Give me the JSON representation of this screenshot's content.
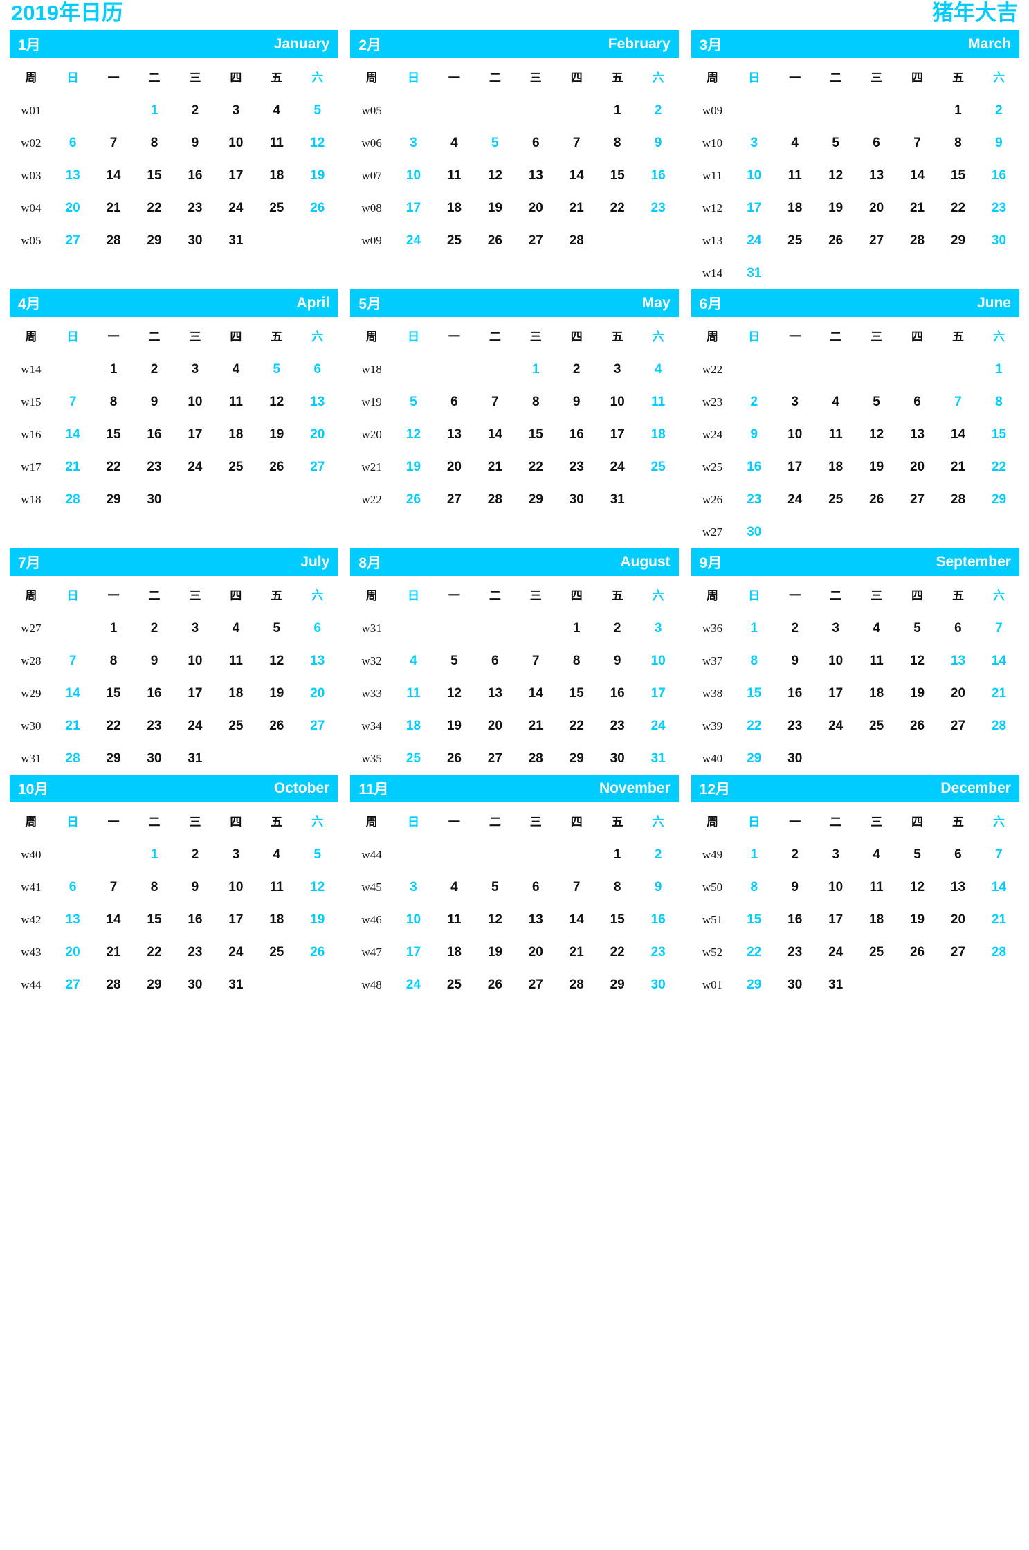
{
  "page": {
    "title_left": "2019年日历",
    "title_right": "猪年大吉",
    "accent_color": "#00ccff",
    "text_color": "#111111",
    "background_color": "#ffffff"
  },
  "weekday_headers": {
    "week_label": "周",
    "days": [
      "日",
      "一",
      "二",
      "三",
      "四",
      "五",
      "六"
    ],
    "weekend_indices": [
      0,
      6
    ]
  },
  "months": [
    {
      "cn": "1月",
      "en": "January",
      "weeks": [
        {
          "w": "w01",
          "days": [
            "",
            "",
            "1",
            "2",
            "3",
            "4",
            "5"
          ],
          "hl": [
            2,
            6
          ]
        },
        {
          "w": "w02",
          "days": [
            "6",
            "7",
            "8",
            "9",
            "10",
            "11",
            "12"
          ],
          "hl": [
            0,
            6
          ]
        },
        {
          "w": "w03",
          "days": [
            "13",
            "14",
            "15",
            "16",
            "17",
            "18",
            "19"
          ],
          "hl": [
            0,
            6
          ]
        },
        {
          "w": "w04",
          "days": [
            "20",
            "21",
            "22",
            "23",
            "24",
            "25",
            "26"
          ],
          "hl": [
            0,
            6
          ]
        },
        {
          "w": "w05",
          "days": [
            "27",
            "28",
            "29",
            "30",
            "31",
            "",
            ""
          ],
          "hl": [
            0
          ]
        }
      ]
    },
    {
      "cn": "2月",
      "en": "February",
      "weeks": [
        {
          "w": "w05",
          "days": [
            "",
            "",
            "",
            "",
            "",
            "1",
            "2"
          ],
          "hl": [
            6
          ]
        },
        {
          "w": "w06",
          "days": [
            "3",
            "4",
            "5",
            "6",
            "7",
            "8",
            "9"
          ],
          "hl": [
            0,
            2,
            6
          ]
        },
        {
          "w": "w07",
          "days": [
            "10",
            "11",
            "12",
            "13",
            "14",
            "15",
            "16"
          ],
          "hl": [
            0,
            6
          ]
        },
        {
          "w": "w08",
          "days": [
            "17",
            "18",
            "19",
            "20",
            "21",
            "22",
            "23"
          ],
          "hl": [
            0,
            6
          ]
        },
        {
          "w": "w09",
          "days": [
            "24",
            "25",
            "26",
            "27",
            "28",
            "",
            ""
          ],
          "hl": [
            0
          ]
        }
      ]
    },
    {
      "cn": "3月",
      "en": "March",
      "weeks": [
        {
          "w": "w09",
          "days": [
            "",
            "",
            "",
            "",
            "",
            "1",
            "2"
          ],
          "hl": [
            6
          ]
        },
        {
          "w": "w10",
          "days": [
            "3",
            "4",
            "5",
            "6",
            "7",
            "8",
            "9"
          ],
          "hl": [
            0,
            6
          ]
        },
        {
          "w": "w11",
          "days": [
            "10",
            "11",
            "12",
            "13",
            "14",
            "15",
            "16"
          ],
          "hl": [
            0,
            6
          ]
        },
        {
          "w": "w12",
          "days": [
            "17",
            "18",
            "19",
            "20",
            "21",
            "22",
            "23"
          ],
          "hl": [
            0,
            6
          ]
        },
        {
          "w": "w13",
          "days": [
            "24",
            "25",
            "26",
            "27",
            "28",
            "29",
            "30"
          ],
          "hl": [
            0,
            6
          ]
        },
        {
          "w": "w14",
          "days": [
            "31",
            "",
            "",
            "",
            "",
            "",
            ""
          ],
          "hl": [
            0
          ]
        }
      ]
    },
    {
      "cn": "4月",
      "en": "April",
      "weeks": [
        {
          "w": "w14",
          "days": [
            "",
            "1",
            "2",
            "3",
            "4",
            "5",
            "6"
          ],
          "hl": [
            5,
            6
          ]
        },
        {
          "w": "w15",
          "days": [
            "7",
            "8",
            "9",
            "10",
            "11",
            "12",
            "13"
          ],
          "hl": [
            0,
            6
          ]
        },
        {
          "w": "w16",
          "days": [
            "14",
            "15",
            "16",
            "17",
            "18",
            "19",
            "20"
          ],
          "hl": [
            0,
            6
          ]
        },
        {
          "w": "w17",
          "days": [
            "21",
            "22",
            "23",
            "24",
            "25",
            "26",
            "27"
          ],
          "hl": [
            0,
            6
          ]
        },
        {
          "w": "w18",
          "days": [
            "28",
            "29",
            "30",
            "",
            "",
            "",
            ""
          ],
          "hl": [
            0
          ]
        }
      ]
    },
    {
      "cn": "5月",
      "en": "May",
      "weeks": [
        {
          "w": "w18",
          "days": [
            "",
            "",
            "",
            "1",
            "2",
            "3",
            "4"
          ],
          "hl": [
            3,
            6
          ]
        },
        {
          "w": "w19",
          "days": [
            "5",
            "6",
            "7",
            "8",
            "9",
            "10",
            "11"
          ],
          "hl": [
            0,
            6
          ]
        },
        {
          "w": "w20",
          "days": [
            "12",
            "13",
            "14",
            "15",
            "16",
            "17",
            "18"
          ],
          "hl": [
            0,
            6
          ]
        },
        {
          "w": "w21",
          "days": [
            "19",
            "20",
            "21",
            "22",
            "23",
            "24",
            "25"
          ],
          "hl": [
            0,
            6
          ]
        },
        {
          "w": "w22",
          "days": [
            "26",
            "27",
            "28",
            "29",
            "30",
            "31",
            ""
          ],
          "hl": [
            0
          ]
        }
      ]
    },
    {
      "cn": "6月",
      "en": "June",
      "weeks": [
        {
          "w": "w22",
          "days": [
            "",
            "",
            "",
            "",
            "",
            "",
            "1"
          ],
          "hl": [
            6
          ]
        },
        {
          "w": "w23",
          "days": [
            "2",
            "3",
            "4",
            "5",
            "6",
            "7",
            "8"
          ],
          "hl": [
            0,
            5,
            6
          ]
        },
        {
          "w": "w24",
          "days": [
            "9",
            "10",
            "11",
            "12",
            "13",
            "14",
            "15"
          ],
          "hl": [
            0,
            6
          ]
        },
        {
          "w": "w25",
          "days": [
            "16",
            "17",
            "18",
            "19",
            "20",
            "21",
            "22"
          ],
          "hl": [
            0,
            6
          ]
        },
        {
          "w": "w26",
          "days": [
            "23",
            "24",
            "25",
            "26",
            "27",
            "28",
            "29"
          ],
          "hl": [
            0,
            6
          ]
        },
        {
          "w": "w27",
          "days": [
            "30",
            "",
            "",
            "",
            "",
            "",
            ""
          ],
          "hl": [
            0
          ]
        }
      ]
    },
    {
      "cn": "7月",
      "en": "July",
      "weeks": [
        {
          "w": "w27",
          "days": [
            "",
            "1",
            "2",
            "3",
            "4",
            "5",
            "6"
          ],
          "hl": [
            6
          ]
        },
        {
          "w": "w28",
          "days": [
            "7",
            "8",
            "9",
            "10",
            "11",
            "12",
            "13"
          ],
          "hl": [
            0,
            6
          ]
        },
        {
          "w": "w29",
          "days": [
            "14",
            "15",
            "16",
            "17",
            "18",
            "19",
            "20"
          ],
          "hl": [
            0,
            6
          ]
        },
        {
          "w": "w30",
          "days": [
            "21",
            "22",
            "23",
            "24",
            "25",
            "26",
            "27"
          ],
          "hl": [
            0,
            6
          ]
        },
        {
          "w": "w31",
          "days": [
            "28",
            "29",
            "30",
            "31",
            "",
            "",
            ""
          ],
          "hl": [
            0
          ]
        }
      ]
    },
    {
      "cn": "8月",
      "en": "August",
      "weeks": [
        {
          "w": "w31",
          "days": [
            "",
            "",
            "",
            "",
            "1",
            "2",
            "3"
          ],
          "hl": [
            6
          ]
        },
        {
          "w": "w32",
          "days": [
            "4",
            "5",
            "6",
            "7",
            "8",
            "9",
            "10"
          ],
          "hl": [
            0,
            6
          ]
        },
        {
          "w": "w33",
          "days": [
            "11",
            "12",
            "13",
            "14",
            "15",
            "16",
            "17"
          ],
          "hl": [
            0,
            6
          ]
        },
        {
          "w": "w34",
          "days": [
            "18",
            "19",
            "20",
            "21",
            "22",
            "23",
            "24"
          ],
          "hl": [
            0,
            6
          ]
        },
        {
          "w": "w35",
          "days": [
            "25",
            "26",
            "27",
            "28",
            "29",
            "30",
            "31"
          ],
          "hl": [
            0,
            6
          ]
        }
      ]
    },
    {
      "cn": "9月",
      "en": "September",
      "weeks": [
        {
          "w": "w36",
          "days": [
            "1",
            "2",
            "3",
            "4",
            "5",
            "6",
            "7"
          ],
          "hl": [
            0,
            6
          ]
        },
        {
          "w": "w37",
          "days": [
            "8",
            "9",
            "10",
            "11",
            "12",
            "13",
            "14"
          ],
          "hl": [
            0,
            5,
            6
          ]
        },
        {
          "w": "w38",
          "days": [
            "15",
            "16",
            "17",
            "18",
            "19",
            "20",
            "21"
          ],
          "hl": [
            0,
            6
          ]
        },
        {
          "w": "w39",
          "days": [
            "22",
            "23",
            "24",
            "25",
            "26",
            "27",
            "28"
          ],
          "hl": [
            0,
            6
          ]
        },
        {
          "w": "w40",
          "days": [
            "29",
            "30",
            "",
            "",
            "",
            "",
            ""
          ],
          "hl": [
            0
          ]
        }
      ]
    },
    {
      "cn": "10月",
      "en": "October",
      "weeks": [
        {
          "w": "w40",
          "days": [
            "",
            "",
            "1",
            "2",
            "3",
            "4",
            "5"
          ],
          "hl": [
            2,
            6
          ]
        },
        {
          "w": "w41",
          "days": [
            "6",
            "7",
            "8",
            "9",
            "10",
            "11",
            "12"
          ],
          "hl": [
            0,
            6
          ]
        },
        {
          "w": "w42",
          "days": [
            "13",
            "14",
            "15",
            "16",
            "17",
            "18",
            "19"
          ],
          "hl": [
            0,
            6
          ]
        },
        {
          "w": "w43",
          "days": [
            "20",
            "21",
            "22",
            "23",
            "24",
            "25",
            "26"
          ],
          "hl": [
            0,
            6
          ]
        },
        {
          "w": "w44",
          "days": [
            "27",
            "28",
            "29",
            "30",
            "31",
            "",
            ""
          ],
          "hl": [
            0
          ]
        }
      ]
    },
    {
      "cn": "11月",
      "en": "November",
      "weeks": [
        {
          "w": "w44",
          "days": [
            "",
            "",
            "",
            "",
            "",
            "1",
            "2"
          ],
          "hl": [
            6
          ]
        },
        {
          "w": "w45",
          "days": [
            "3",
            "4",
            "5",
            "6",
            "7",
            "8",
            "9"
          ],
          "hl": [
            0,
            6
          ]
        },
        {
          "w": "w46",
          "days": [
            "10",
            "11",
            "12",
            "13",
            "14",
            "15",
            "16"
          ],
          "hl": [
            0,
            6
          ]
        },
        {
          "w": "w47",
          "days": [
            "17",
            "18",
            "19",
            "20",
            "21",
            "22",
            "23"
          ],
          "hl": [
            0,
            6
          ]
        },
        {
          "w": "w48",
          "days": [
            "24",
            "25",
            "26",
            "27",
            "28",
            "29",
            "30"
          ],
          "hl": [
            0,
            6
          ]
        }
      ]
    },
    {
      "cn": "12月",
      "en": "December",
      "weeks": [
        {
          "w": "w49",
          "days": [
            "1",
            "2",
            "3",
            "4",
            "5",
            "6",
            "7"
          ],
          "hl": [
            0,
            6
          ]
        },
        {
          "w": "w50",
          "days": [
            "8",
            "9",
            "10",
            "11",
            "12",
            "13",
            "14"
          ],
          "hl": [
            0,
            6
          ]
        },
        {
          "w": "w51",
          "days": [
            "15",
            "16",
            "17",
            "18",
            "19",
            "20",
            "21"
          ],
          "hl": [
            0,
            6
          ]
        },
        {
          "w": "w52",
          "days": [
            "22",
            "23",
            "24",
            "25",
            "26",
            "27",
            "28"
          ],
          "hl": [
            0,
            6
          ]
        },
        {
          "w": "w01",
          "days": [
            "29",
            "30",
            "31",
            "",
            "",
            "",
            ""
          ],
          "hl": [
            0
          ]
        }
      ]
    }
  ]
}
